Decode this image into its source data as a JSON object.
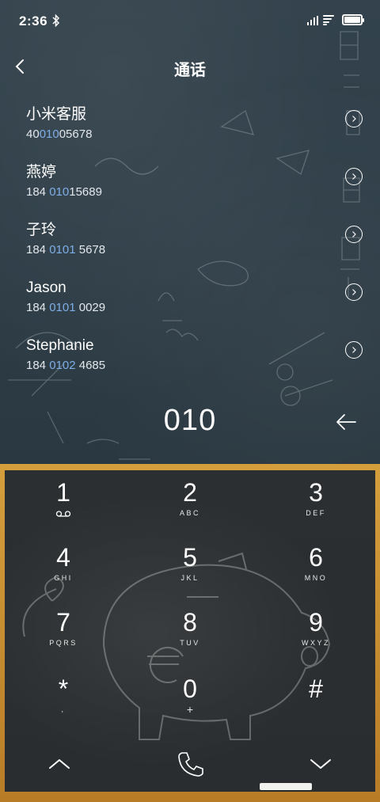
{
  "status_bar": {
    "time": "2:36",
    "icons": [
      "bluetooth-icon",
      "signal-icon",
      "wifi-icon",
      "battery-icon"
    ]
  },
  "header": {
    "title": "通话",
    "back_icon": "chevron-left-icon"
  },
  "contacts": [
    {
      "name": "小米客服",
      "number_before": "40",
      "number_match": "010",
      "number_after": "05678"
    },
    {
      "name": "燕婷",
      "number_before": "184 ",
      "number_match": "010",
      "number_after": "15689"
    },
    {
      "name": "子玲",
      "number_before": "184 ",
      "number_match": "0101",
      "number_after": " 5678"
    },
    {
      "name": "Jason",
      "number_before": "184 ",
      "number_match": "0101",
      "number_after": " 0029"
    },
    {
      "name": "Stephanie",
      "number_before": "184 ",
      "number_match": "0102",
      "number_after": " 4685"
    }
  ],
  "dialer": {
    "input_value": "010",
    "backspace_icon": "backspace-arrow-icon"
  },
  "keypad": {
    "keys": [
      {
        "digit": "1",
        "letters": ""
      },
      {
        "digit": "2",
        "letters": "ABC"
      },
      {
        "digit": "3",
        "letters": "DEF"
      },
      {
        "digit": "4",
        "letters": "GHI"
      },
      {
        "digit": "5",
        "letters": "JKL"
      },
      {
        "digit": "6",
        "letters": "MNO"
      },
      {
        "digit": "7",
        "letters": "PQRS"
      },
      {
        "digit": "8",
        "letters": "TUV"
      },
      {
        "digit": "9",
        "letters": "WXYZ"
      },
      {
        "digit": "*",
        "letters": ","
      },
      {
        "digit": "0",
        "letters": "+"
      },
      {
        "digit": "#",
        "letters": ""
      }
    ],
    "bottom_icons": [
      "chevron-up-icon",
      "phone-call-icon",
      "chevron-down-icon"
    ]
  },
  "colors": {
    "board": "#2f3e48",
    "keypad_board": "#2a2e30",
    "frame": "#c98b2f",
    "match_highlight": "#7eaee8"
  }
}
